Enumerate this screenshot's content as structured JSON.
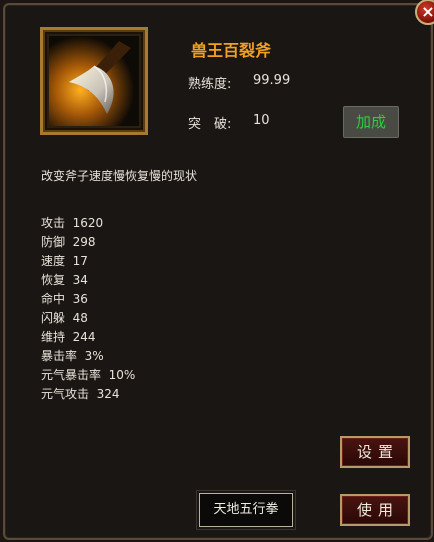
{
  "item": {
    "name": "兽王百裂斧",
    "proficiency_label": "熟练度:",
    "proficiency_value": "99.99",
    "break_label": "突　破:",
    "break_value": "10",
    "upgrade_button": "加成",
    "description": "改变斧子速度慢恢复慢的现状",
    "icon": "axe-icon"
  },
  "stats": [
    {
      "label": "攻击",
      "value": "1620"
    },
    {
      "label": "防御",
      "value": "298"
    },
    {
      "label": "速度",
      "value": "17"
    },
    {
      "label": "恢复",
      "value": "34"
    },
    {
      "label": "命中",
      "value": "36"
    },
    {
      "label": "闪躲",
      "value": "48"
    },
    {
      "label": "维持",
      "value": "244"
    },
    {
      "label": "暴击率",
      "value": "3%"
    },
    {
      "label": "元气暴击率",
      "value": "10%"
    },
    {
      "label": "元气攻击",
      "value": "324"
    }
  ],
  "buttons": {
    "settings": "设置",
    "use": "使用",
    "skill": "天地五行拳"
  },
  "colors": {
    "name": "#f2a020",
    "upgrade_text": "#28d03a"
  }
}
